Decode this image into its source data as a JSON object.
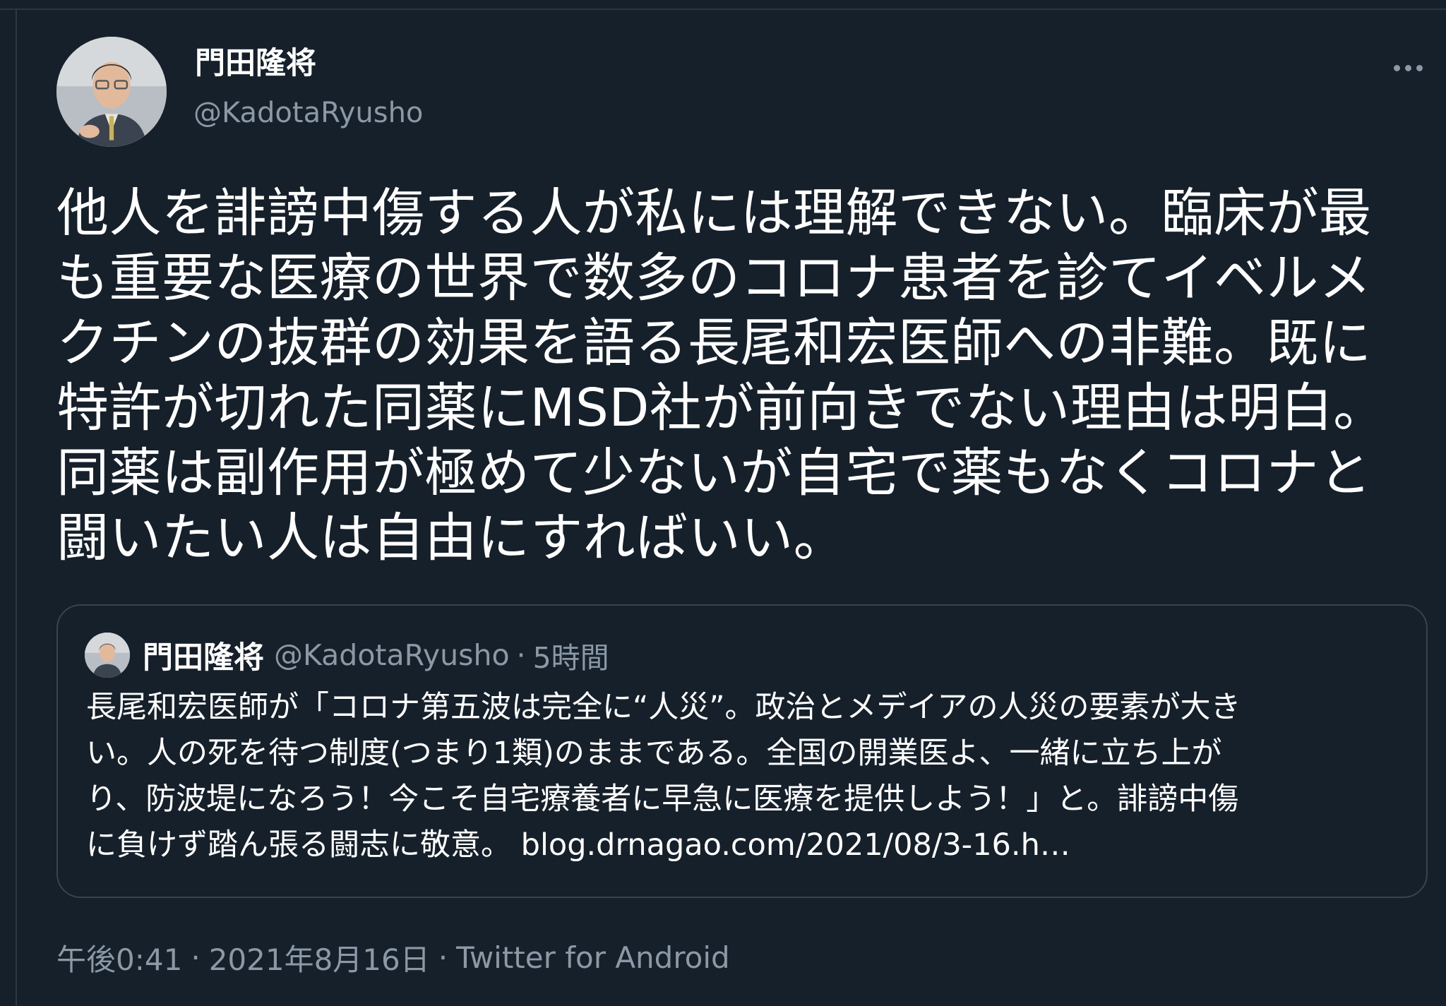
{
  "tweet": {
    "author": {
      "display_name": "門田隆将",
      "handle": "@KadotaRyusho",
      "avatar": "profile-photo"
    },
    "more_icon": "more-horizontal-icon",
    "text": "他人を誹謗中傷する人が私には理解できない。臨床が最\nも重要な医療の世界で数多のコロナ患者を診てイベルメ\nクチンの抜群の効果を語る長尾和宏医師への非難。既に\n特許が切れた同薬にMSD社が前向きでない理由は明白。\n同薬は副作用が極めて少ないが自宅で薬もなくコロナと\n闘いたい人は自由にすればいい。",
    "quoted": {
      "display_name": "門田隆将",
      "handle": "@KadotaRyusho",
      "separator": "·",
      "time": "5時間",
      "text": "長尾和宏医師が「コロナ第五波は完全に“人災”。政治とメデイアの人災の要素が大き\nい。人の死を待つ制度(つまり1類)のままである。全国の開業医よ、一緒に立ち上が\nり、防波堤になろう！今こそ自宅療養者に早急に医療を提供しよう！」と。誹謗中傷\nに負けず踏ん張る闘志に敬意。 ",
      "link": "blog.drnagao.com/2021/08/3-16.h…"
    },
    "meta": {
      "time": "午後0:41",
      "separator": "·",
      "date": "2021年8月16日",
      "source": "Twitter for Android"
    }
  },
  "colors": {
    "background": "#15202b",
    "text_primary": "#ffffff",
    "text_secondary": "#8b98a5",
    "border": "#38444d"
  }
}
